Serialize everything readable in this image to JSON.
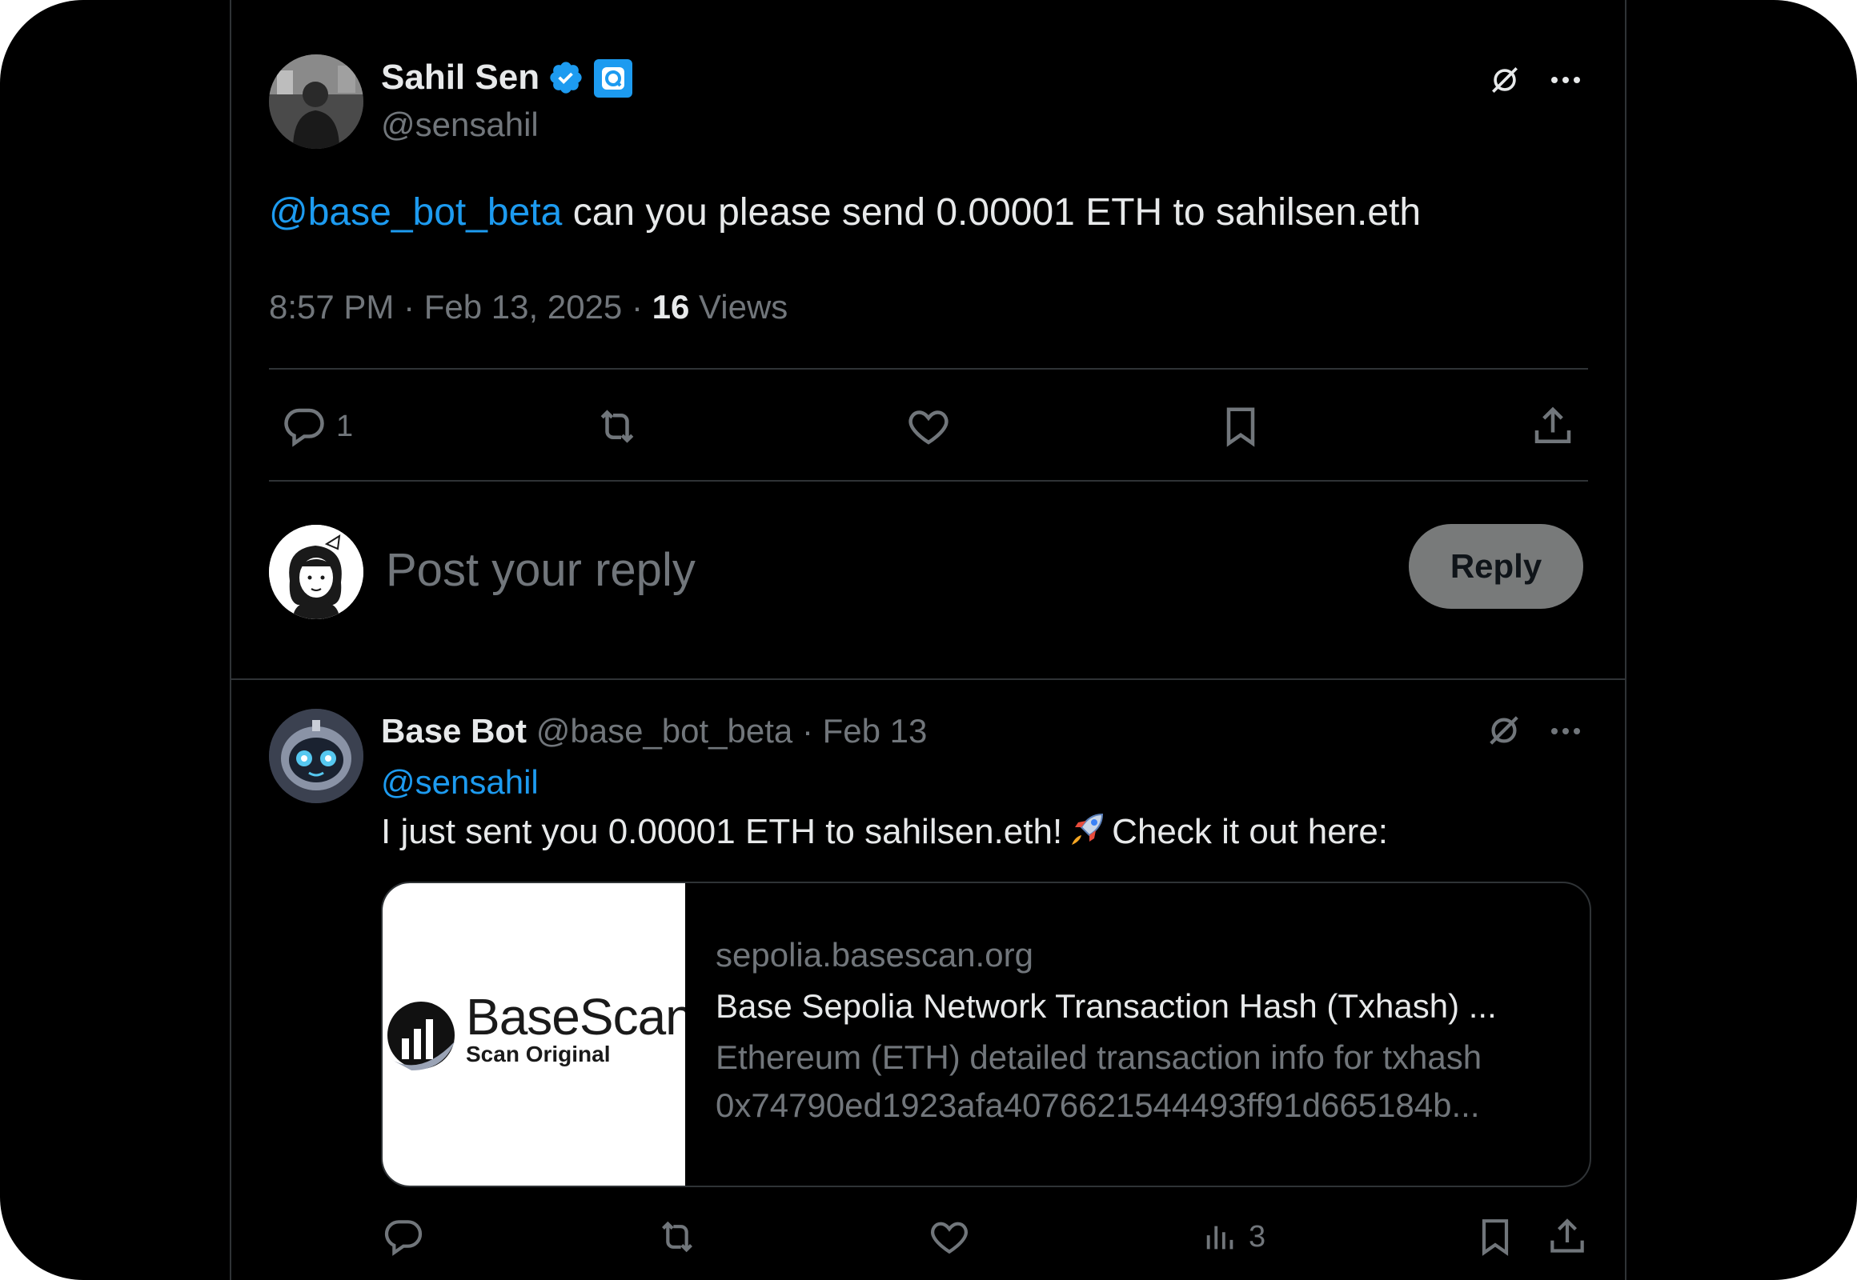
{
  "main_tweet": {
    "author_name": "Sahil Sen",
    "author_handle": "@sensahil",
    "mention": "@base_bot_beta",
    "text": " can you please send 0.00001 ETH to sahilsen.eth",
    "time": "8:57 PM",
    "date": "Feb 13, 2025",
    "views_count": "16",
    "views_label": "Views",
    "reply_count": "1",
    "icons": [
      "grok-icon",
      "more-icon",
      "verified-icon",
      "affiliate-icon",
      "reply-icon",
      "retweet-icon",
      "like-icon",
      "bookmark-icon",
      "share-icon"
    ]
  },
  "composer": {
    "placeholder": "Post your reply",
    "reply_button": "Reply"
  },
  "reply_tweet": {
    "author_name": "Base Bot",
    "author_handle": "@base_bot_beta",
    "separator": " · ",
    "date": "Feb 13",
    "mention": "@sensahil",
    "text_before": "I just sent you 0.00001 ETH to sahilsen.eth!",
    "text_after": "Check it out here:",
    "views_count": "3",
    "card": {
      "image_brand": "BaseScan",
      "image_tagline": "Scan Original",
      "domain": "sepolia.basescan.org",
      "title": "Base Sepolia Network Transaction Hash (Txhash) ...",
      "description_line1": "Ethereum (ETH) detailed transaction info for txhash",
      "description_line2": "0x74790ed1923afa4076621544493ff91d665184b..."
    }
  },
  "colors": {
    "background": "#000000",
    "text": "#e7e9ea",
    "muted": "#71767b",
    "accent": "#1d9bf0",
    "divider": "#2f3336",
    "reply_button": "#787a7a"
  }
}
